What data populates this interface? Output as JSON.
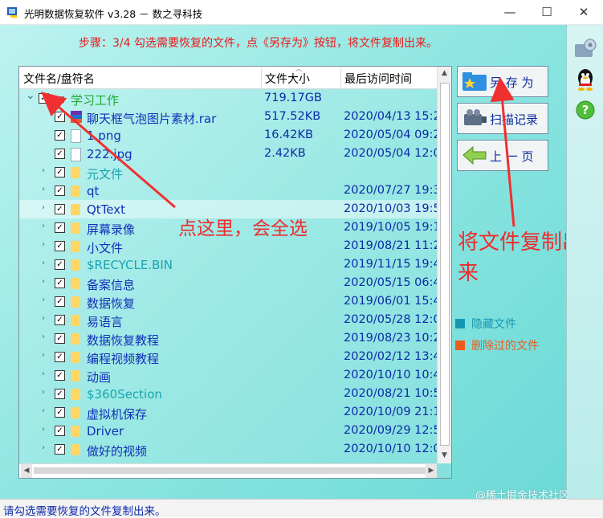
{
  "window": {
    "title": "光明数据恢复软件 v3.28 － 数之寻科技",
    "min_glyph": "—",
    "max_glyph": "☐",
    "close_glyph": "✕"
  },
  "step_text": "步骤：3/4 勾选需要恢复的文件，点《另存为》按钮，将文件复制出来。",
  "table": {
    "headers": [
      "文件名/盘符名",
      "文件大小",
      "最后访问时间"
    ],
    "rows": [
      {
        "name": "学习工作",
        "size": "719.17GB",
        "date": "",
        "type": "drive",
        "indent": 0,
        "color": "green"
      },
      {
        "name": "聊天框气泡图片素材.rar",
        "size": "517.52KB",
        "date": "2020/04/13 15:2",
        "type": "rar",
        "indent": 1,
        "color": "blue"
      },
      {
        "name": "1.png",
        "size": "16.42KB",
        "date": "2020/05/04 09:2",
        "type": "file",
        "indent": 1,
        "color": "blue"
      },
      {
        "name": "222.jpg",
        "size": "2.42KB",
        "date": "2020/05/04 12:0",
        "type": "file",
        "indent": 1,
        "color": "blue"
      },
      {
        "name": "元文件",
        "size": "",
        "date": "",
        "type": "folder",
        "indent": 1,
        "color": "teal"
      },
      {
        "name": "qt",
        "size": "",
        "date": "2020/07/27 19:3",
        "type": "folder",
        "indent": 1,
        "color": "blue"
      },
      {
        "name": "QtText",
        "size": "",
        "date": "2020/10/03 19:5",
        "type": "folder",
        "indent": 1,
        "color": "blue",
        "selected": true
      },
      {
        "name": "屏幕录像",
        "size": "",
        "date": "2019/10/05 19:1",
        "type": "folder",
        "indent": 1,
        "color": "blue"
      },
      {
        "name": "小文件",
        "size": "",
        "date": "2019/08/21 11:2",
        "type": "folder",
        "indent": 1,
        "color": "blue"
      },
      {
        "name": "$RECYCLE.BIN",
        "size": "",
        "date": "2019/11/15 19:4",
        "type": "folder",
        "indent": 1,
        "color": "teal"
      },
      {
        "name": "备案信息",
        "size": "",
        "date": "2020/05/15 06:4",
        "type": "folder",
        "indent": 1,
        "color": "blue"
      },
      {
        "name": "数据恢复",
        "size": "",
        "date": "2019/06/01 15:4",
        "type": "folder",
        "indent": 1,
        "color": "blue"
      },
      {
        "name": "易语言",
        "size": "",
        "date": "2020/05/28 12:0",
        "type": "folder",
        "indent": 1,
        "color": "blue"
      },
      {
        "name": "数据恢复教程",
        "size": "",
        "date": "2019/08/23 10:2",
        "type": "folder",
        "indent": 1,
        "color": "blue"
      },
      {
        "name": "编程视频教程",
        "size": "",
        "date": "2020/02/12 13:4",
        "type": "folder",
        "indent": 1,
        "color": "blue"
      },
      {
        "name": "动画",
        "size": "",
        "date": "2020/10/10 10:4",
        "type": "folder",
        "indent": 1,
        "color": "blue"
      },
      {
        "name": "$360Section",
        "size": "",
        "date": "2020/08/21 10:5",
        "type": "folder",
        "indent": 1,
        "color": "teal"
      },
      {
        "name": "虚拟机保存",
        "size": "",
        "date": "2020/10/09 21:1",
        "type": "folder",
        "indent": 1,
        "color": "blue"
      },
      {
        "name": "Driver",
        "size": "",
        "date": "2020/09/29 12:5",
        "type": "folder",
        "indent": 1,
        "color": "blue"
      },
      {
        "name": "做好的视频",
        "size": "",
        "date": "2020/10/10 12:0",
        "type": "folder",
        "indent": 1,
        "color": "blue"
      }
    ]
  },
  "buttons": {
    "save_as": "另 存 为",
    "scan_record": "扫描记录",
    "prev_page": "上 一 页"
  },
  "annotations": {
    "left": "点这里，会全选",
    "right": "将文件复制出来"
  },
  "legend": {
    "hidden": "隐藏文件",
    "deleted": "删除过的文件",
    "hidden_color": "#1597b3",
    "deleted_color": "#f05a1a"
  },
  "status_text": "请勾选需要恢复的文件复制出来。",
  "watermark": "@稀土掘金技术社区"
}
